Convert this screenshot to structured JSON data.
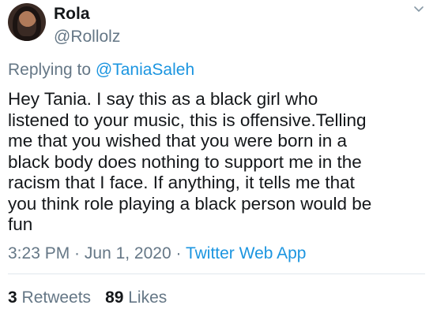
{
  "author": {
    "name": "Rola",
    "handle": "@Rollolz"
  },
  "reply": {
    "prefix": "Replying to ",
    "mention": "@TaniaSaleh"
  },
  "tweet": {
    "text": "Hey Tania. I say this as a black girl who\nlistened to your music, this is offensive.Telling\nme that you wished that you were born in a\nblack body does nothing to support me in the\nracism that I face. If anything, it tells me that\nyou think role playing a black person would be\nfun",
    "time": "3:23 PM",
    "separator": " · ",
    "date": "Jun 1, 2020",
    "separator2": " · ",
    "source": "Twitter Web App"
  },
  "stats": {
    "retweets_count": "3",
    "retweets_label": " Retweets",
    "likes_count": "89",
    "likes_label": " Likes"
  },
  "icons": {
    "menu": "chevron-down-icon"
  },
  "colors": {
    "link": "#1b95e0",
    "secondary_text": "#657786",
    "primary_text": "#14171a"
  }
}
